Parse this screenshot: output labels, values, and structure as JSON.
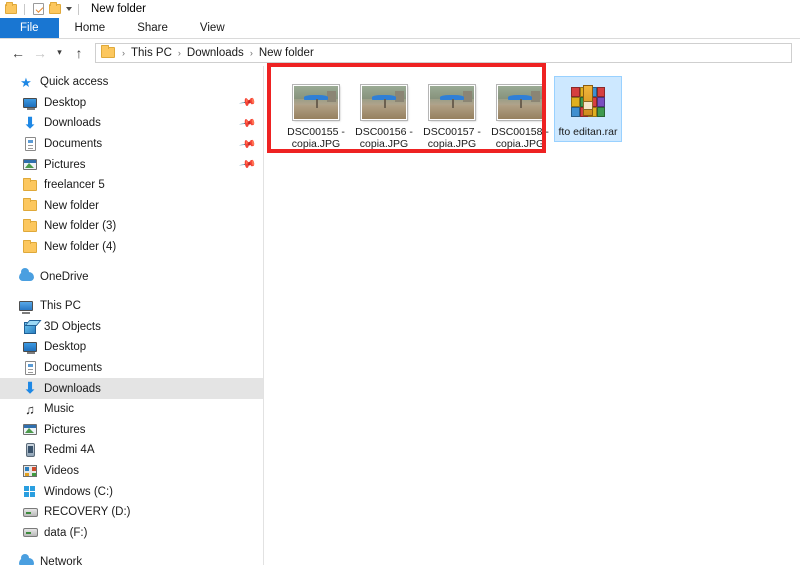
{
  "window": {
    "title": "New folder",
    "quick_access_toolbar": [
      {
        "name": "folder-icon",
        "label": "Folder"
      },
      {
        "name": "properties-icon",
        "label": "Properties"
      },
      {
        "name": "new-folder-icon",
        "label": "New folder"
      },
      {
        "name": "chevron-down-icon",
        "label": "Customize Quick Access Toolbar"
      }
    ]
  },
  "ribbon": {
    "tabs": [
      {
        "label": "File",
        "active": true
      },
      {
        "label": "Home",
        "active": false
      },
      {
        "label": "Share",
        "active": false
      },
      {
        "label": "View",
        "active": false
      }
    ]
  },
  "addressbar": {
    "back_icon": "back-arrow-icon",
    "forward_icon": "forward-arrow-icon",
    "recent_icon": "recent-locations-icon",
    "up_icon": "up-arrow-icon",
    "breadcrumbs": [
      "This PC",
      "Downloads",
      "New folder"
    ],
    "separator": "›"
  },
  "navpane": {
    "groups": [
      {
        "header": {
          "label": "Quick access",
          "icon": "star-icon"
        },
        "items": [
          {
            "label": "Desktop",
            "icon": "desktop-icon",
            "pinned": true
          },
          {
            "label": "Downloads",
            "icon": "download-icon",
            "pinned": true
          },
          {
            "label": "Documents",
            "icon": "document-icon",
            "pinned": true
          },
          {
            "label": "Pictures",
            "icon": "pictures-icon",
            "pinned": true
          },
          {
            "label": "freelancer 5",
            "icon": "folder-icon",
            "pinned": false
          },
          {
            "label": "New folder",
            "icon": "folder-icon",
            "pinned": false
          },
          {
            "label": "New folder (3)",
            "icon": "folder-icon",
            "pinned": false
          },
          {
            "label": "New folder (4)",
            "icon": "folder-icon",
            "pinned": false
          }
        ]
      },
      {
        "header": {
          "label": "OneDrive",
          "icon": "cloud-icon"
        },
        "items": []
      },
      {
        "header": {
          "label": "This PC",
          "icon": "this-pc-icon"
        },
        "items": [
          {
            "label": "3D Objects",
            "icon": "3d-objects-icon",
            "selected": false
          },
          {
            "label": "Desktop",
            "icon": "desktop-icon",
            "selected": false
          },
          {
            "label": "Documents",
            "icon": "document-icon",
            "selected": false
          },
          {
            "label": "Downloads",
            "icon": "download-icon",
            "selected": true
          },
          {
            "label": "Music",
            "icon": "music-icon",
            "selected": false
          },
          {
            "label": "Pictures",
            "icon": "pictures-icon",
            "selected": false
          },
          {
            "label": "Redmi 4A",
            "icon": "phone-icon",
            "selected": false
          },
          {
            "label": "Videos",
            "icon": "videos-icon",
            "selected": false
          },
          {
            "label": "Windows (C:)",
            "icon": "windows-drive-icon",
            "selected": false
          },
          {
            "label": "RECOVERY (D:)",
            "icon": "drive-icon",
            "selected": false
          },
          {
            "label": "data (F:)",
            "icon": "drive-icon",
            "selected": false
          }
        ]
      },
      {
        "header": {
          "label": "Network",
          "icon": "network-icon"
        },
        "items": []
      }
    ]
  },
  "filelist": {
    "items": [
      {
        "name": "DSC00155 - copia.JPG",
        "type": "image",
        "selected": false
      },
      {
        "name": "DSC00156 - copia.JPG",
        "type": "image",
        "selected": false
      },
      {
        "name": "DSC00157 - copia.JPG",
        "type": "image",
        "selected": false
      },
      {
        "name": "DSC00158 - copia.JPG",
        "type": "image",
        "selected": false
      },
      {
        "name": "fto editan.rar",
        "type": "archive",
        "selected": true
      }
    ]
  },
  "annotation": {
    "shape": "rectangle",
    "color": "#ee2222",
    "targets": [
      "DSC00155 - copia.JPG",
      "DSC00156 - copia.JPG",
      "DSC00157 - copia.JPG",
      "DSC00158 - copia.JPG"
    ]
  },
  "colors": {
    "accent": "#1976d2",
    "selection": "#cde8ff",
    "nav_selection": "#e4e4e4",
    "annotation": "#ee2222",
    "folder_yellow": "#fcc75e"
  }
}
